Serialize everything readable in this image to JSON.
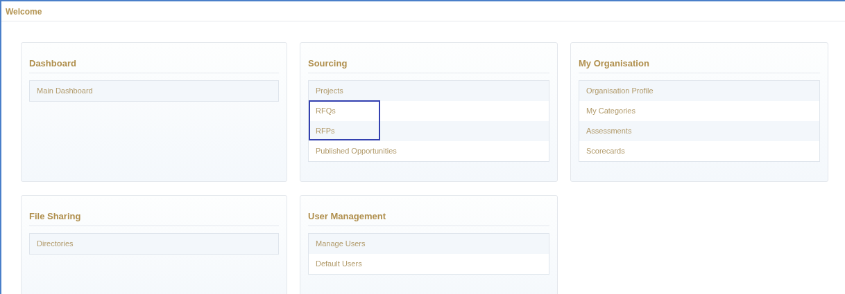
{
  "page": {
    "title": "Welcome"
  },
  "panels": [
    {
      "title": "Dashboard",
      "items": [
        {
          "label": "Main Dashboard",
          "highlighted": false
        }
      ]
    },
    {
      "title": "Sourcing",
      "items": [
        {
          "label": "Projects",
          "highlighted": false
        },
        {
          "label": "RFQs",
          "highlighted": true
        },
        {
          "label": "RFPs",
          "highlighted": true
        },
        {
          "label": "Published Opportunities",
          "highlighted": false
        }
      ]
    },
    {
      "title": "My Organisation",
      "items": [
        {
          "label": "Organisation Profile",
          "highlighted": false
        },
        {
          "label": "My Categories",
          "highlighted": false
        },
        {
          "label": "Assessments",
          "highlighted": false
        },
        {
          "label": "Scorecards",
          "highlighted": false
        }
      ]
    },
    {
      "title": "File Sharing",
      "items": [
        {
          "label": "Directories",
          "highlighted": false
        }
      ]
    },
    {
      "title": "User Management",
      "items": [
        {
          "label": "Manage Users",
          "highlighted": false
        },
        {
          "label": "Default Users",
          "highlighted": false
        }
      ]
    }
  ]
}
